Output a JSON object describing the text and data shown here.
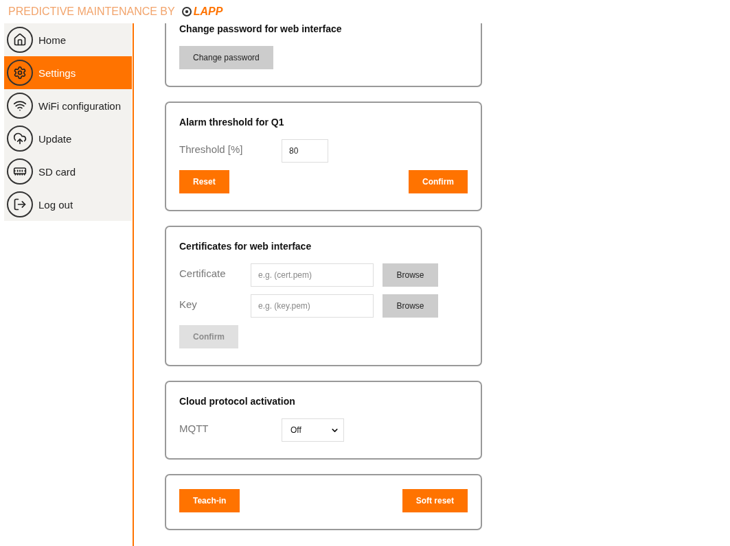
{
  "header": {
    "title": "PREDICTIVE MAINTENANCE BY",
    "brand": "LAPP"
  },
  "sidebar": {
    "items": [
      {
        "label": "Home",
        "selected": false
      },
      {
        "label": "Settings",
        "selected": true
      },
      {
        "label": "WiFi configuration",
        "selected": false
      },
      {
        "label": "Update",
        "selected": false
      },
      {
        "label": "SD card",
        "selected": false
      },
      {
        "label": "Log out",
        "selected": false
      }
    ]
  },
  "sections": [
    {
      "title": "Change password for web interface",
      "rows": [
        {
          "kind": "buttons",
          "buttons": [
            {
              "label": "Change password",
              "kind": "secondary",
              "disabled": false
            }
          ]
        }
      ]
    },
    {
      "title": "Alarm threshold for Q1",
      "rows": [
        {
          "kind": "input",
          "label": "Threshold [%]",
          "value": "80"
        },
        {
          "kind": "buttons",
          "buttons": [
            {
              "label": "Reset",
              "kind": "primary",
              "disabled": false
            },
            {
              "label": "Confirm",
              "kind": "primary",
              "disabled": false
            }
          ]
        }
      ]
    },
    {
      "title": "Certificates for web interface",
      "rows": [
        {
          "kind": "file",
          "label": "Certificate",
          "placeholder": "e.g. (cert.pem)",
          "button": "Browse"
        },
        {
          "kind": "file",
          "label": "Key",
          "placeholder": "e.g. (key.pem)",
          "button": "Browse"
        },
        {
          "kind": "buttons",
          "buttons": [
            {
              "label": "Confirm",
              "kind": "primary",
              "disabled": true
            }
          ]
        }
      ]
    },
    {
      "title": "Cloud protocol activation",
      "rows": [
        {
          "kind": "select",
          "label": "MQTT",
          "value": "Off"
        }
      ]
    },
    {
      "rows": [
        {
          "kind": "buttons",
          "buttons": [
            {
              "label": "Teach-in",
              "kind": "primary",
              "disabled": false
            },
            {
              "label": "Soft reset",
              "kind": "primary",
              "disabled": false
            }
          ]
        }
      ]
    }
  ]
}
